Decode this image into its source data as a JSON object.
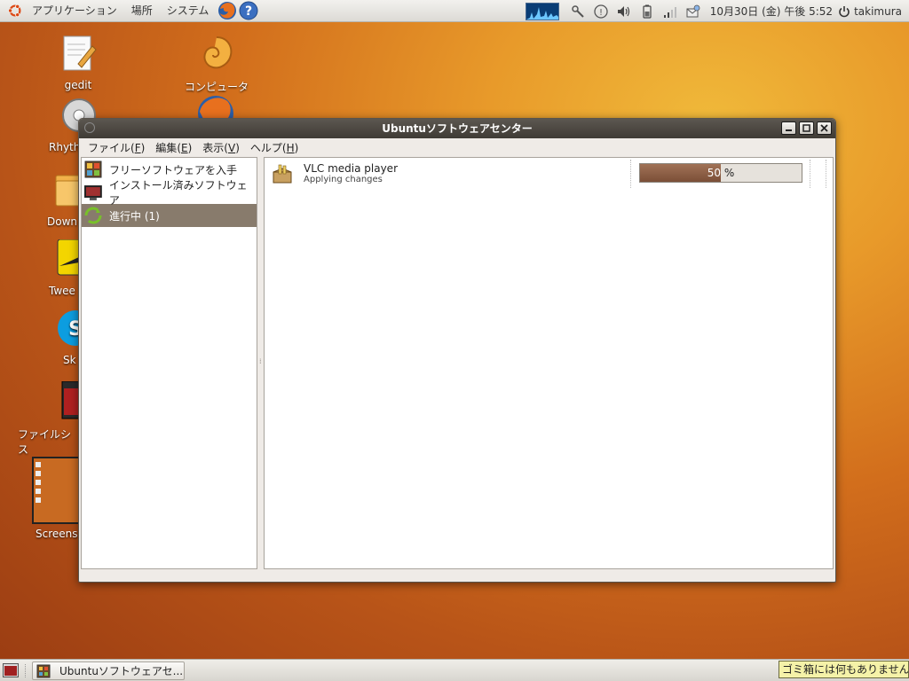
{
  "top_panel": {
    "menus": [
      "アプリケーション",
      "場所",
      "システム"
    ],
    "clock": "10月30日 (金) 午後 5:52",
    "user": "takimura",
    "launchers": [
      "firefox-icon",
      "help-icon"
    ],
    "tray_icons": [
      "system-monitor",
      "network-manager-icon",
      "weather-icon",
      "volume-icon",
      "battery-icon",
      "signal-icon",
      "mail-icon"
    ]
  },
  "desktop_icons": [
    {
      "label": "gedit",
      "icon": "text-editor-icon"
    },
    {
      "label": "コンピュータ",
      "icon": "computer-icon"
    },
    {
      "label": "Rhyth",
      "icon": "rhythmbox-icon"
    },
    {
      "label": "Down",
      "icon": "folder-icon"
    },
    {
      "label": "Twee",
      "icon": "tweetdeck-icon"
    },
    {
      "label": "Sk",
      "icon": "skype-icon"
    },
    {
      "label": "ファイルシス",
      "icon": "filesystem-icon"
    },
    {
      "label": "Screens",
      "icon": "screenshot-thumbnail"
    }
  ],
  "window": {
    "title": "Ubuntuソフトウェアセンター",
    "menus": [
      {
        "label": "ファイル",
        "mnemonic": "F"
      },
      {
        "label": "編集",
        "mnemonic": "E"
      },
      {
        "label": "表示",
        "mnemonic": "V"
      },
      {
        "label": "ヘルプ",
        "mnemonic": "H"
      }
    ],
    "sidebar": [
      {
        "label": "フリーソフトウェアを入手",
        "icon": "get-software-icon",
        "active": false
      },
      {
        "label": "インストール済みソフトウェア",
        "icon": "installed-software-icon",
        "active": false
      },
      {
        "label": "進行中 (1)",
        "icon": "in-progress-icon",
        "active": true
      }
    ],
    "transactions": [
      {
        "name": "VLC media player",
        "status": "Applying changes",
        "progress_percent": 50,
        "progress_value": "50",
        "progress_unit": "%"
      }
    ]
  },
  "taskbar": {
    "tasks": [
      {
        "label": "Ubuntuソフトウェアセ..."
      }
    ],
    "trash_tooltip": "ゴミ箱には何もありません"
  },
  "colors": {
    "selection": "#887b6c",
    "progress_fill": "#8a5b41",
    "titlebar": "#4a4640"
  }
}
